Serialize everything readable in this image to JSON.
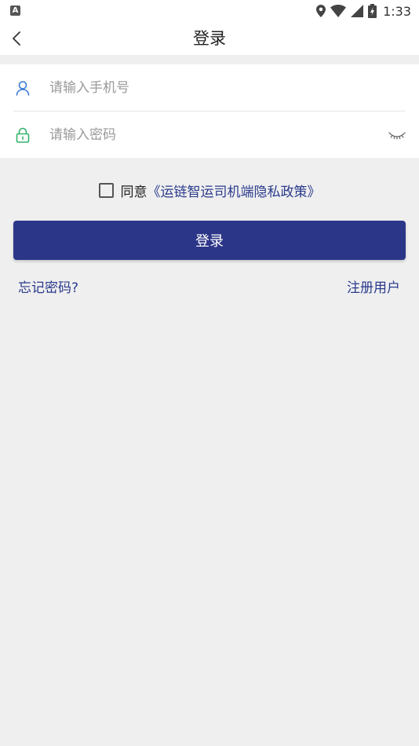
{
  "status_bar": {
    "left_icon": "A",
    "time": "1:33",
    "icons": [
      "location-icon",
      "wifi-icon",
      "signal-icon",
      "battery-icon"
    ]
  },
  "header": {
    "title": "登录",
    "back_icon": "chevron-left-icon"
  },
  "form": {
    "phone": {
      "placeholder": "请输入手机号",
      "value": "",
      "icon": "user-icon",
      "icon_color": "#3a7bd5"
    },
    "password": {
      "placeholder": "请输入密码",
      "value": "",
      "icon": "lock-icon",
      "icon_color": "#34b36b",
      "toggle_icon": "eye-closed-icon"
    }
  },
  "agreement": {
    "checked": false,
    "label": "同意",
    "link": "《运链智运司机端隐私政策》"
  },
  "login_button": {
    "label": "登录"
  },
  "links": {
    "forgot_password": "忘记密码?",
    "register": "注册用户"
  },
  "colors": {
    "primary": "#2c3688",
    "link": "#2a3a8c",
    "background": "#efefef"
  }
}
